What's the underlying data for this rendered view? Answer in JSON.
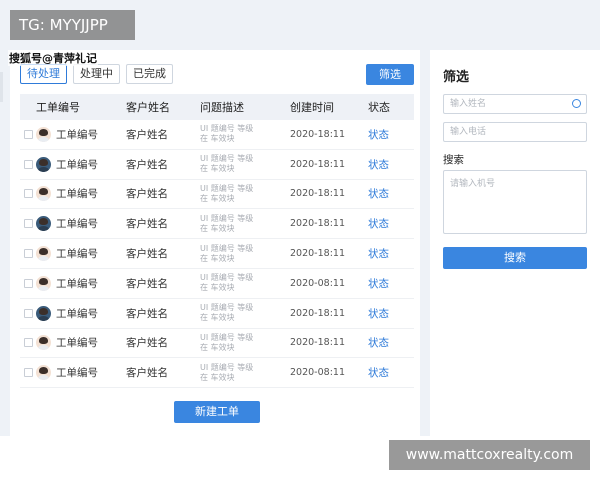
{
  "overlay": {
    "tag": "TG: MYYJJPP",
    "source_watermark": "搜狐号@青萍礼记",
    "url": "www.mattcoxrealty.com"
  },
  "tabs": [
    {
      "label": "待处理",
      "active": true
    },
    {
      "label": "处理中",
      "active": false
    },
    {
      "label": "已完成",
      "active": false
    }
  ],
  "toolbar": {
    "filter_label": "筛选"
  },
  "table": {
    "headers": [
      "工单编号",
      "客户姓名",
      "问题描述",
      "创建时间",
      "状态"
    ],
    "rows": [
      {
        "id": "工单编号",
        "name": "客户姓名",
        "desc1": "UI 题编号   等级",
        "desc2": "在 车效块",
        "time": "2020-18:11",
        "status": "状态"
      },
      {
        "id": "工单编号",
        "name": "客户姓名",
        "desc1": "UI 题编号   等级",
        "desc2": "在 车效块",
        "time": "2020-18:11",
        "status": "状态"
      },
      {
        "id": "工单编号",
        "name": "客户姓名",
        "desc1": "UI 题编号   等级",
        "desc2": "在 车效块",
        "time": "2020-18:11",
        "status": "状态"
      },
      {
        "id": "工单编号",
        "name": "客户姓名",
        "desc1": "UI 题编号   等级",
        "desc2": "在 车效块",
        "time": "2020-18:11",
        "status": "状态"
      },
      {
        "id": "工单编号",
        "name": "客户姓名",
        "desc1": "UI 题编号   等级",
        "desc2": "在 车效块",
        "time": "2020-18:11",
        "status": "状态"
      },
      {
        "id": "工单编号",
        "name": "客户姓名",
        "desc1": "UI 题编号   等级",
        "desc2": "在 车效块",
        "time": "2020-08:11",
        "status": "状态"
      },
      {
        "id": "工单编号",
        "name": "客户姓名",
        "desc1": "UI 题编号   等级",
        "desc2": "在 车效块",
        "time": "2020-18:11",
        "status": "状态"
      },
      {
        "id": "工单编号",
        "name": "客户姓名",
        "desc1": "UI 题编号   等级",
        "desc2": "在 车效块",
        "time": "2020-18:11",
        "status": "状态"
      },
      {
        "id": "工单编号",
        "name": "客户姓名",
        "desc1": "UI 题编号   等级",
        "desc2": "在 车效块",
        "time": "2020-08:11",
        "status": "状态"
      }
    ],
    "new_button": "新建工单"
  },
  "filter_panel": {
    "title": "筛选",
    "name_placeholder": "输入姓名",
    "phone_placeholder": "输入电话",
    "search_label": "搜索",
    "search_placeholder": "请输入机号",
    "search_button": "搜索"
  },
  "colors": {
    "accent": "#3a86e0",
    "background": "#eef2f7"
  },
  "icons": {
    "search": "search-icon",
    "avatar": "avatar"
  }
}
